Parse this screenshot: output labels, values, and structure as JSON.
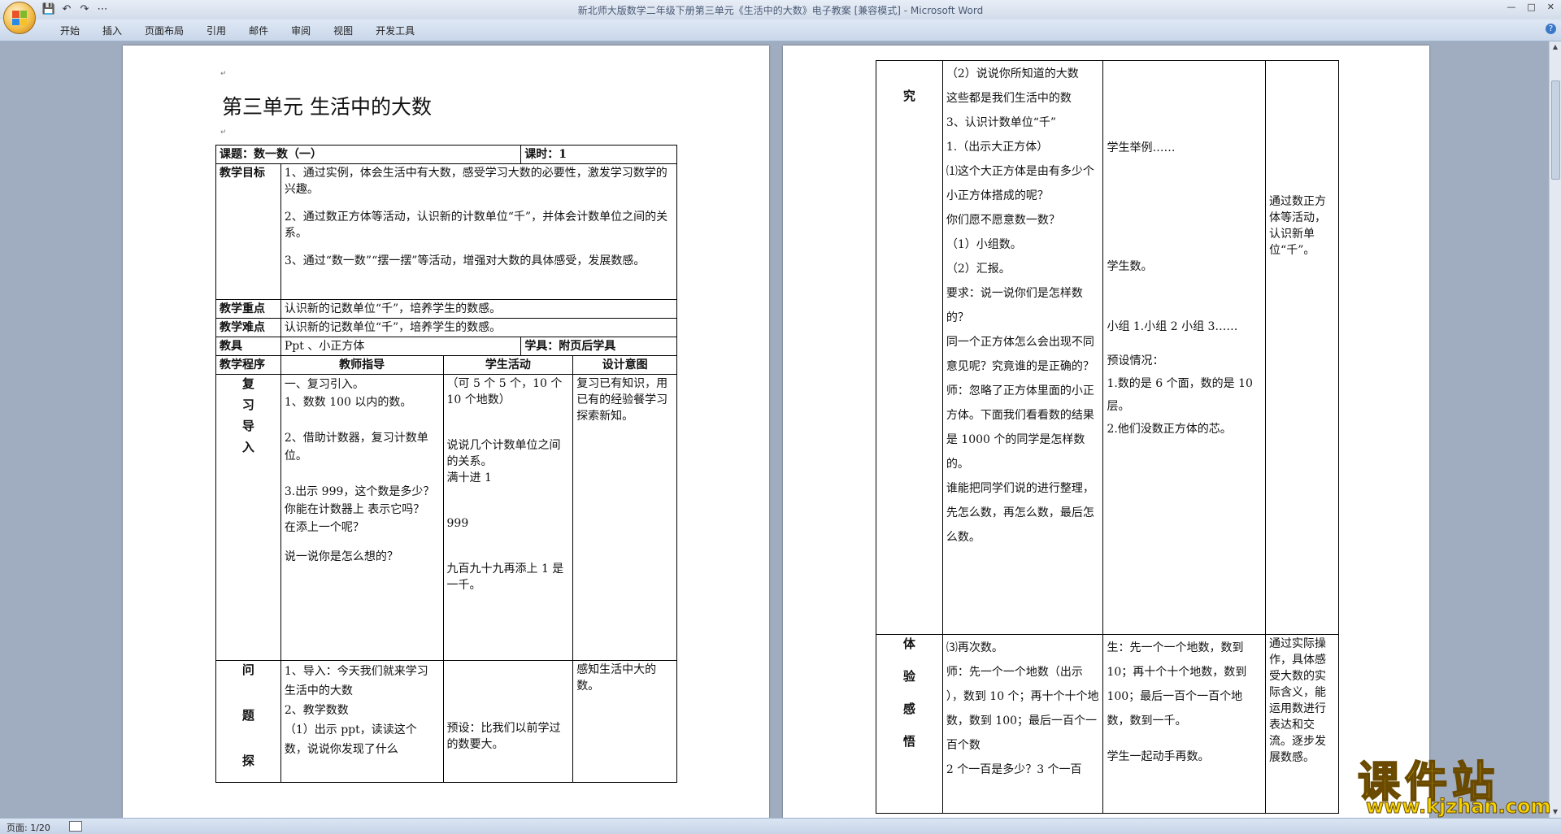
{
  "window": {
    "title": "新北师大版数学二年级下册第三单元《生活中的大数》电子教案 [兼容模式] - Microsoft Word",
    "controls": [
      "—",
      "□",
      "✕"
    ]
  },
  "qat": {
    "save_icon": "save-icon",
    "undo_icon": "undo-icon",
    "redo_icon": "redo-icon",
    "more": "⋯"
  },
  "ribbon": {
    "tabs": [
      "开始",
      "插入",
      "页面布局",
      "引用",
      "邮件",
      "审阅",
      "视图",
      "开发工具"
    ]
  },
  "status": {
    "page": "页面: 1/20"
  },
  "page1": {
    "heading": "第三单元 生活中的大数",
    "topic": "课题：数一数（一）",
    "hours": "课时：1",
    "goals_label": "教学目标",
    "goals": [
      "1、通过实例，体会生活中有大数，感受学习大数的必要性，激发学习数学的兴趣。",
      "2、通过数正方体等活动，认识新的计数单位“千”，并体会计数单位之间的关系。",
      "3、通过“数一数”“摆一摆”等活动，增强对大数的具体感受，发展数感。"
    ],
    "key_label": "教学重点",
    "key": "认识新的记数单位“千”，培养学生的数感。",
    "diff_label": "教学难点",
    "diff": "认识新的记数单位“千”，培养学生的数感。",
    "tools_label": "教具",
    "tools": "Ppt 、小正方体",
    "study_tools": "学具：附页后学具",
    "h_proc": "教学程序",
    "h_teacher": "教师指导",
    "h_student": "学生活动",
    "h_intent": "设计意图",
    "sec1_label": [
      "复",
      "习",
      "导",
      "入"
    ],
    "sec1_teacher": [
      "一、复习引入。",
      "1、数数 100 以内的数。",
      "2、借助计数器，复习计数单位。",
      "3.出示 999，这个数是多少？",
      "你能在计数器上  表示它吗？",
      "在添上一个呢？",
      "说一说你是怎么想的？"
    ],
    "sec1_student": [
      "（可 5 个 5 个，10 个 10 个地数）",
      "说说几个计数单位之间的关系。",
      "满十进 1",
      "999",
      "九百九十九再添上 1 是一千。"
    ],
    "sec1_intent": "复习已有知识，用已有的经验餐学习探索新知。",
    "sec2_label": [
      "问",
      "题",
      "探"
    ],
    "sec2_teacher": [
      "1、导入：今天我们就来学习生活中的大数",
      "2、教学数数",
      "（1）出示 ppt，读读这个数，说说你发现了什么"
    ],
    "sec2_student": "预设：比我们以前学过的数要大。",
    "sec2_intent": "感知生活中大的数。"
  },
  "page2": {
    "sec_label": "究",
    "teacher": [
      "（2）说说你所知道的大数",
      "这些都是我们生活中的数",
      "3、认识计数单位“千”",
      "1.（出示大正方体）",
      "⑴这个大正方体是由有多少个小正方体搭成的呢？",
      "你们愿不愿意数一数？",
      "（1）小组数。",
      "（2）汇报。",
      "要求：说一说你们是怎样数的？",
      "同一个正方体怎么会出现不同意见呢？究竟谁的是正确的？",
      "师：忽略了正方体里面的小正方体。下面我们看看数的结果是 1000 个的同学是怎样数的。",
      "谁能把同学们说的进行整理，先怎么数，再怎么数，最后怎么数。"
    ],
    "student": [
      "学生举例……",
      "学生数。",
      "小组 1.小组 2 小组 3……",
      "预设情况：",
      "1.数的是 6 个面，数的是 10 层。",
      "2.他们没数正方体的芯。"
    ],
    "intent": "通过数正方体等活动，认识新单位“千”。",
    "sec2_label": [
      "体",
      "验",
      "感",
      "悟"
    ],
    "teacher2": [
      "⑶再次数。",
      "师：先一个一个地数（出示         ），数到 10 个；再十个十个地数，数到 100；最后一百个一百个数",
      "2 个一百是多少？3 个一百"
    ],
    "student2": [
      "生：先一个一个地数，数到 10；再十个十个地数，数到 100；最后一百个一百个地数，数到一千。",
      "学生一起动手再数。"
    ],
    "intent2": "通过实际操作，具体感受大数的实际含义，能运用数进行表达和交流。逐步发展数感。"
  },
  "watermark": {
    "name": "课件站",
    "url": "www.kjzhan.com"
  }
}
